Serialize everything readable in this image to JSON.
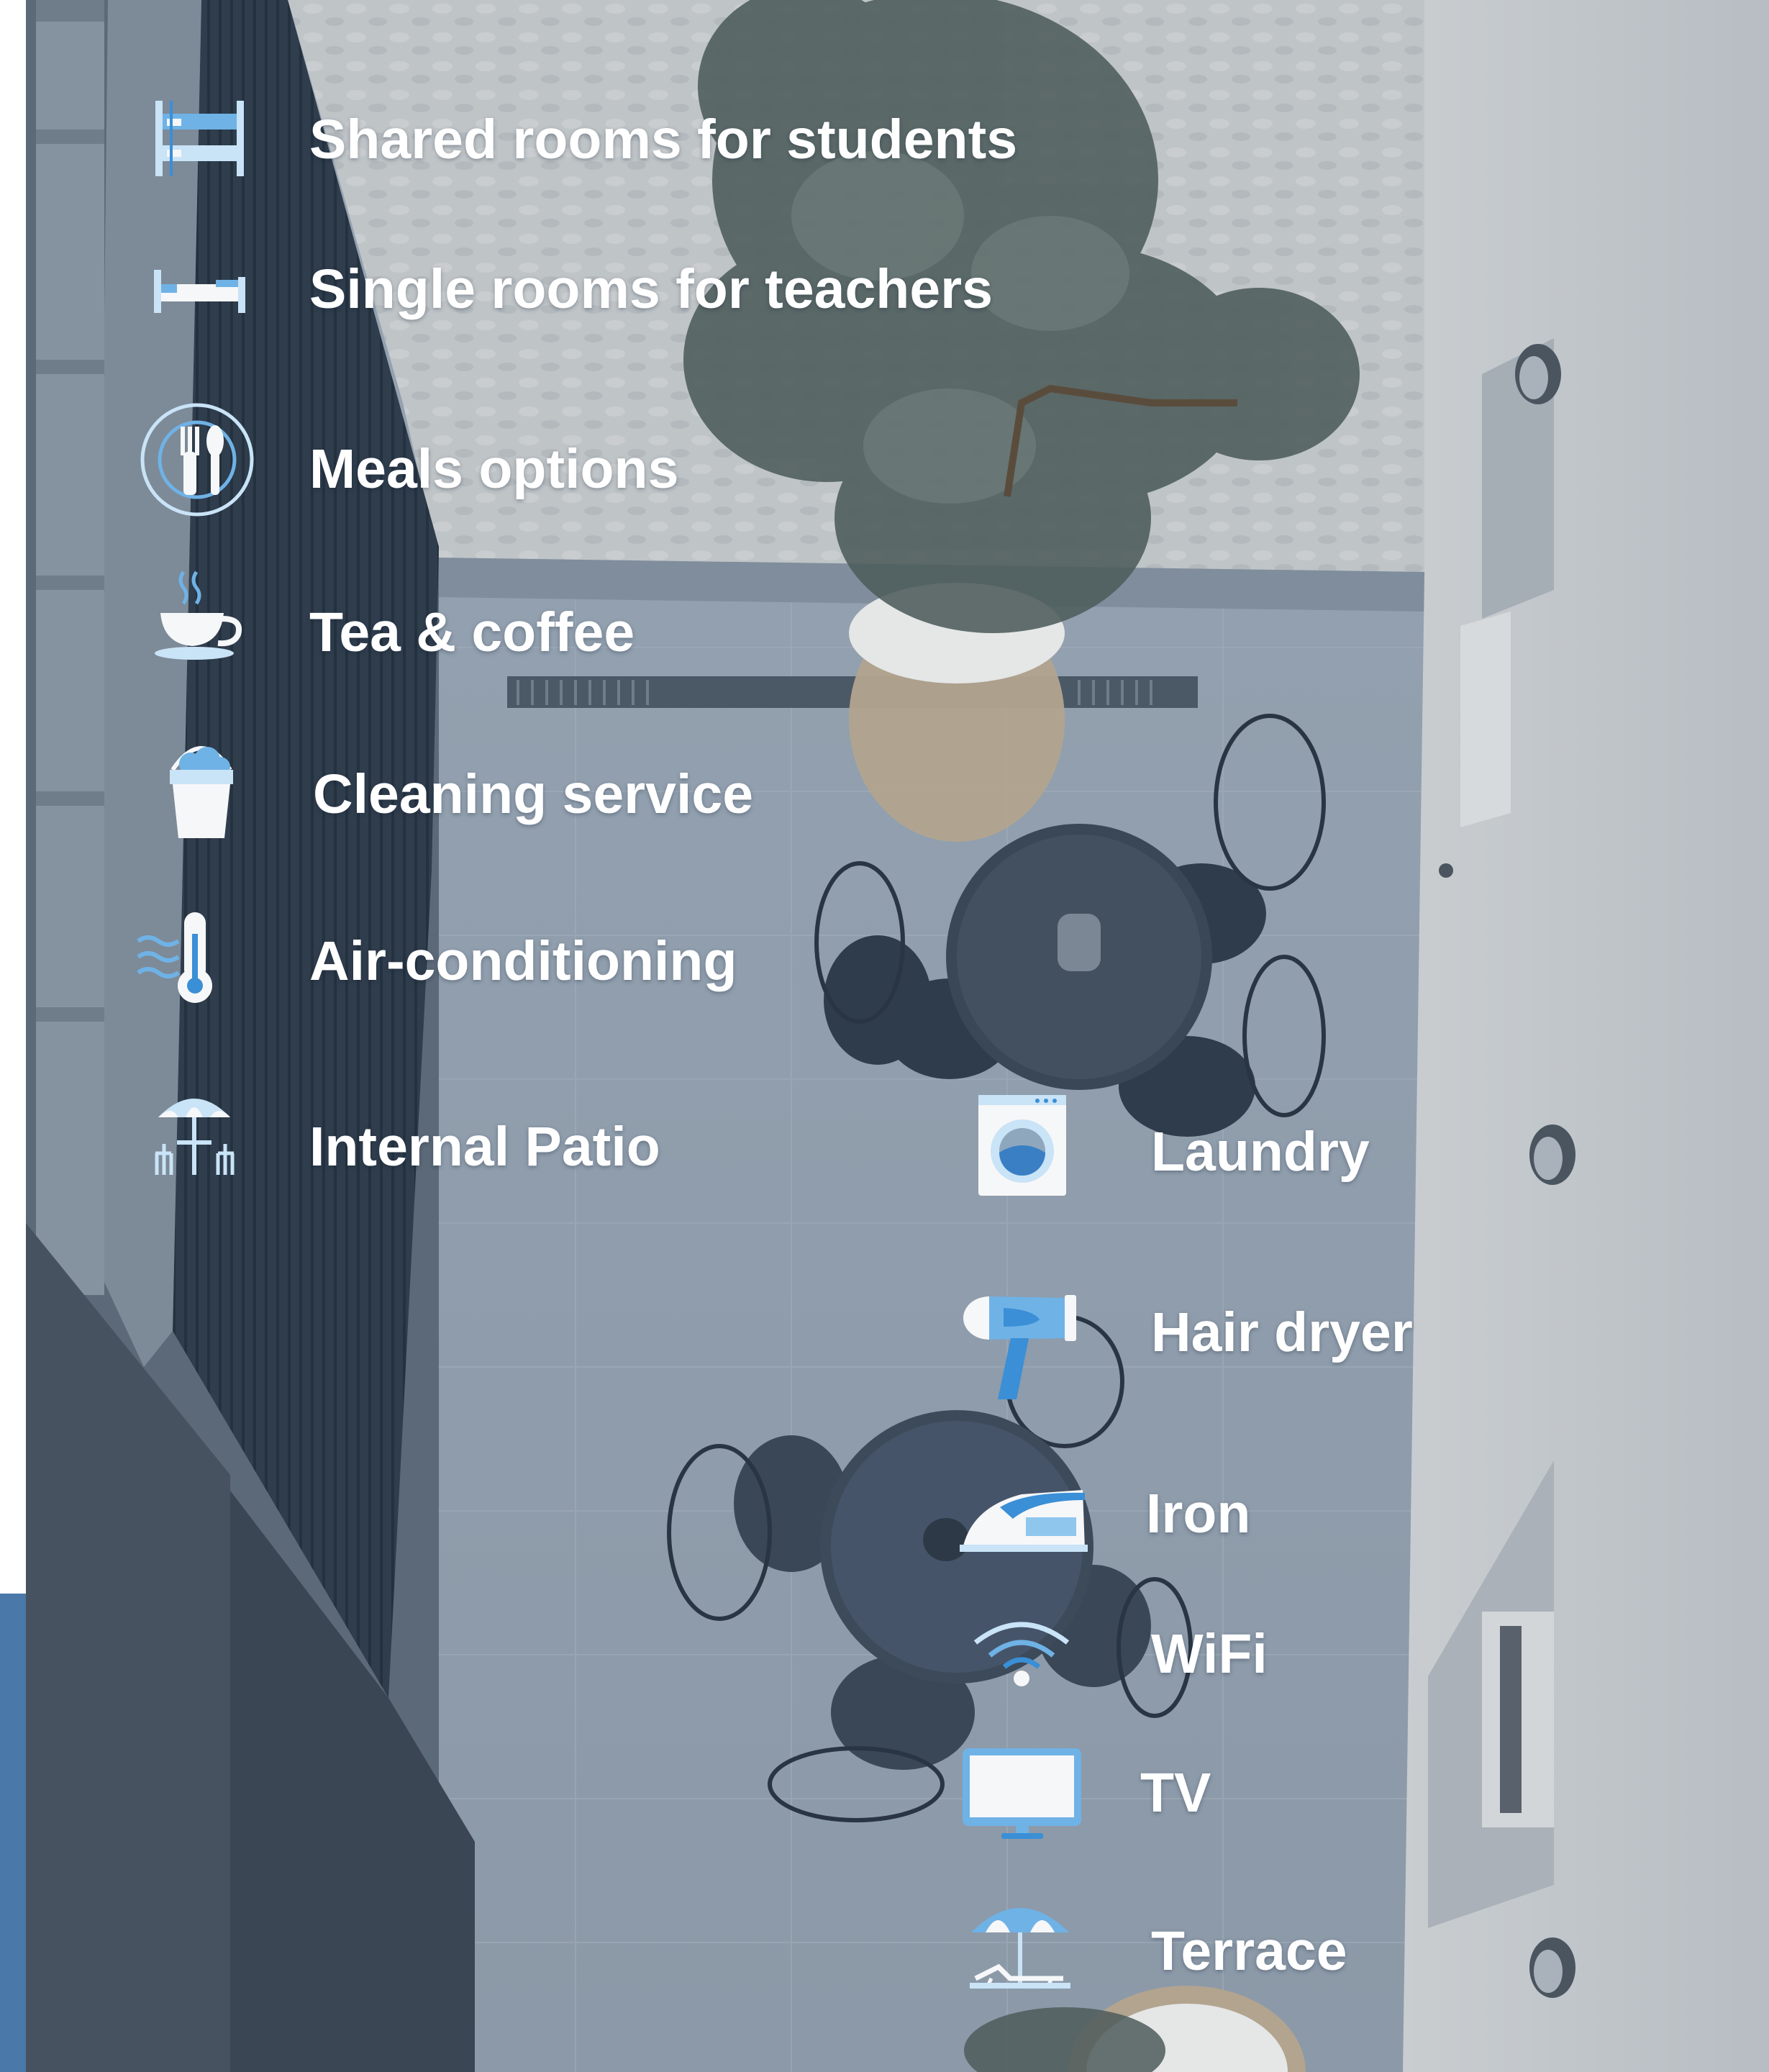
{
  "amenities_left": [
    {
      "label": "Shared rooms for students",
      "icon": "bunk-bed-icon"
    },
    {
      "label": "Single rooms for teachers",
      "icon": "single-bed-icon"
    },
    {
      "label": "Meals options",
      "icon": "cutlery-plate-icon"
    },
    {
      "label": "Tea & coffee",
      "icon": "coffee-cup-icon"
    },
    {
      "label": "Cleaning service",
      "icon": "cleaning-bucket-icon"
    },
    {
      "label": "Air-conditioning",
      "icon": "thermometer-icon"
    },
    {
      "label": "Internal Patio",
      "icon": "patio-umbrella-table-icon"
    }
  ],
  "amenities_right": [
    {
      "label": "Laundry",
      "icon": "washing-machine-icon"
    },
    {
      "label": "Hair dryer",
      "icon": "hair-dryer-icon"
    },
    {
      "label": "Iron",
      "icon": "iron-icon"
    },
    {
      "label": "WiFi",
      "icon": "wifi-icon"
    },
    {
      "label": "TV",
      "icon": "tv-monitor-icon"
    },
    {
      "label": "Terrace",
      "icon": "beach-umbrella-icon"
    }
  ],
  "colors": {
    "icon_light": "#c9e3f7",
    "icon_mid": "#6fb2e6",
    "icon_strong": "#3a8fd6",
    "icon_white": "#f6f7f8",
    "text": "#ffffff",
    "accent_bar": "#4a78a8"
  }
}
